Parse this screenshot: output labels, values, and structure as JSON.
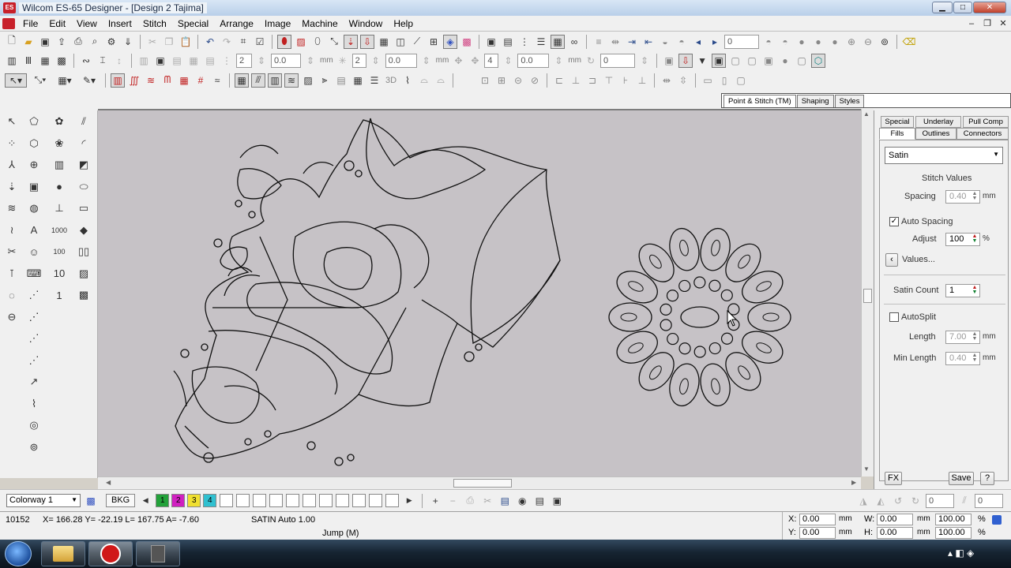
{
  "window": {
    "app_icon": "ES",
    "title": "Wilcom ES-65 Designer - [Design 2       Tajima]",
    "minimize": "▁",
    "maximize": "□",
    "close": "✕"
  },
  "menu": [
    "File",
    "Edit",
    "View",
    "Insert",
    "Stitch",
    "Special",
    "Arrange",
    "Image",
    "Machine",
    "Window",
    "Help"
  ],
  "mdi": {
    "minimize": "–",
    "restore": "❐",
    "close": "✕"
  },
  "toolbar1": {
    "icons": [
      "new-file-icon",
      "open-folder-icon",
      "save-icon",
      "export-icon",
      "print-icon",
      "print-preview-icon",
      "settings-icon",
      "send-icon",
      "cut-icon",
      "copy-icon",
      "paste-icon",
      "undo-icon",
      "redo-icon",
      "hoop-icon",
      "check-icon",
      "fill-icon",
      "pattern-icon",
      "outline-icon",
      "pointer-icon",
      "needle-icon",
      "grid-icon",
      "layout-icon",
      "measure-icon",
      "color-icon",
      "palette-icon"
    ],
    "stitch_count_value": "0"
  },
  "toolbar2": {
    "field1": "2",
    "field2": "0.0",
    "field3": "2",
    "field4": "0.0",
    "field5": "4",
    "field6": "0.0",
    "field7": "0",
    "unit": "mm"
  },
  "toolbar3": {
    "three_d_label": "3D"
  },
  "doc_tabs": [
    "Point & Stitch (TM)",
    "Shaping",
    "Styles"
  ],
  "toolbox": {
    "tools": [
      {
        "name": "select-arrow-icon",
        "glyph": "↖"
      },
      {
        "name": "reshape-icon",
        "glyph": "⬠"
      },
      {
        "name": "flower-icon",
        "glyph": "✿"
      },
      {
        "name": "hatch-icon",
        "glyph": "⫽"
      },
      {
        "name": "polyselect-icon",
        "glyph": "⁘"
      },
      {
        "name": "shape-icon",
        "glyph": "⬡"
      },
      {
        "name": "flower-green-icon",
        "glyph": "❀"
      },
      {
        "name": "arc-icon",
        "glyph": "◜"
      },
      {
        "name": "branch-icon",
        "glyph": "⅄"
      },
      {
        "name": "wheel-icon",
        "glyph": "⊕"
      },
      {
        "name": "satin-icon",
        "glyph": "▥"
      },
      {
        "name": "fill-shape-icon",
        "glyph": "◩"
      },
      {
        "name": "needle-icon",
        "glyph": "⇣"
      },
      {
        "name": "frame-icon",
        "glyph": "▣"
      },
      {
        "name": "color-icon",
        "glyph": "●"
      },
      {
        "name": "ellipse-icon",
        "glyph": "⬭"
      },
      {
        "name": "zigzag-icon",
        "glyph": "≋"
      },
      {
        "name": "globe-icon",
        "glyph": "◍"
      },
      {
        "name": "pin-icon",
        "glyph": "⊥"
      },
      {
        "name": "rectangle-icon",
        "glyph": "▭"
      },
      {
        "name": "motif-icon",
        "glyph": "≀"
      },
      {
        "name": "lettering-icon",
        "glyph": "A"
      },
      {
        "name": "count-1000-icon",
        "glyph": "1000"
      },
      {
        "name": "stamp-icon",
        "glyph": "◆"
      },
      {
        "name": "scissors-icon",
        "glyph": "✂"
      },
      {
        "name": "people-icon",
        "glyph": "☺"
      },
      {
        "name": "count-100-icon",
        "glyph": "100"
      },
      {
        "name": "binoculars-icon",
        "glyph": "▯▯"
      },
      {
        "name": "tie-in-icon",
        "glyph": "⊺"
      },
      {
        "name": "machine-icon",
        "glyph": "⌨"
      },
      {
        "name": "count-10-icon",
        "glyph": "10"
      },
      {
        "name": "texture-icon",
        "glyph": "▨"
      },
      {
        "name": "hoop-icon",
        "glyph": "◌"
      },
      {
        "name": "run-icon",
        "glyph": "⋰"
      },
      {
        "name": "count-1-icon",
        "glyph": "1"
      },
      {
        "name": "gradient-icon",
        "glyph": "▩"
      },
      {
        "name": "lasso-icon",
        "glyph": "⊖"
      },
      {
        "name": "dot-line-icon",
        "glyph": "⋰"
      },
      {
        "name": "dashed-line-icon",
        "glyph": "⋰"
      },
      {
        "name": "line-icon",
        "glyph": "⋰"
      },
      {
        "name": "zigzag-line-icon",
        "glyph": "⋰"
      },
      {
        "name": "node-line-icon",
        "glyph": "↗"
      },
      {
        "name": "wave-line-icon",
        "glyph": "⌇"
      },
      {
        "name": "pick-icon",
        "glyph": "◎"
      },
      {
        "name": "target-icon",
        "glyph": "⊚"
      }
    ]
  },
  "panel": {
    "tabs_row1": [
      "Special",
      "Underlay",
      "Pull Comp"
    ],
    "tabs_row2": [
      "Fills",
      "Outlines",
      "Connectors"
    ],
    "fill_type": "Satin",
    "section_title": "Stitch Values",
    "spacing_label": "Spacing",
    "spacing_value": "0.40",
    "auto_spacing_label": "Auto Spacing",
    "auto_spacing_check": "✓",
    "adjust_label": "Adjust",
    "adjust_value": "100",
    "percent": "%",
    "values_button": "Values...",
    "satin_count_label": "Satin Count",
    "satin_count_value": "1",
    "autosplit_label": "AutoSplit",
    "autosplit_check": "",
    "length_label": "Length",
    "length_value": "7.00",
    "min_length_label": "Min Length",
    "min_length_value": "0.40",
    "unit": "mm",
    "fx_button": "FX",
    "save_button": "Save",
    "help_button": "?"
  },
  "colorbar": {
    "colorway": "Colorway 1",
    "bkg": "BKG",
    "swatches": [
      {
        "label": "1",
        "color": "#23a23a"
      },
      {
        "label": "2",
        "color": "#d020c0"
      },
      {
        "label": "3",
        "color": "#f0e030"
      },
      {
        "label": "4",
        "color": "#30c0d0"
      }
    ],
    "value_a": "0",
    "value_b": "0"
  },
  "status": {
    "stitch_count": "10152",
    "coords": "X= 166.28 Y= -22.19 L= 167.75 A=  -7.60",
    "stitch_type": "SATIN Auto  1.00",
    "mode": "Jump (M)",
    "x_label": "X:",
    "x_value": "0.00",
    "y_label": "Y:",
    "y_value": "0.00",
    "w_label": "W:",
    "w_value": "0.00",
    "h_label": "H:",
    "h_value": "0.00",
    "unit": "mm",
    "w_pct": "100.00",
    "h_pct": "100.00",
    "pct": "%"
  }
}
